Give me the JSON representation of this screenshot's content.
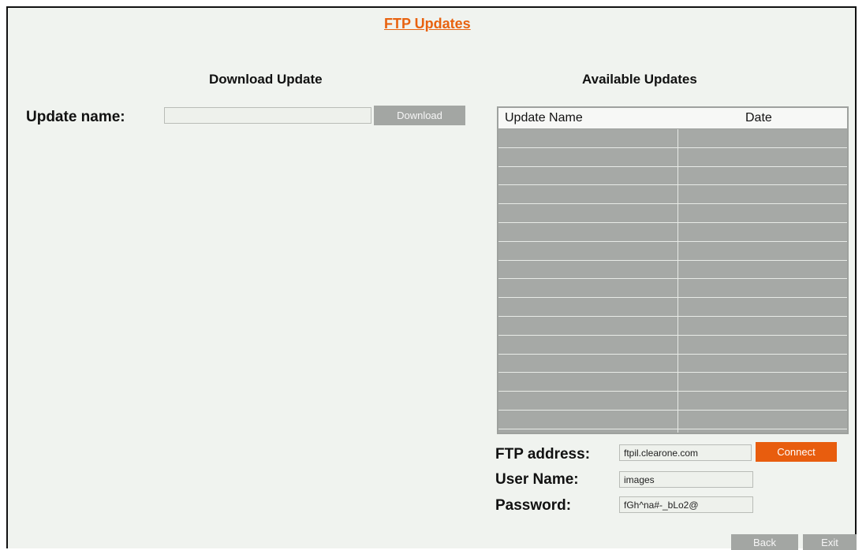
{
  "page": {
    "title": "FTP Updates"
  },
  "download": {
    "section_title": "Download Update",
    "update_name_label": "Update name:",
    "update_name_value": "",
    "download_button": "Download"
  },
  "available": {
    "section_title": "Available Updates",
    "columns": [
      "Update Name",
      "Date"
    ],
    "rows": [
      [
        "",
        ""
      ],
      [
        "",
        ""
      ],
      [
        "",
        ""
      ],
      [
        "",
        ""
      ],
      [
        "",
        ""
      ],
      [
        "",
        ""
      ],
      [
        "",
        ""
      ],
      [
        "",
        ""
      ],
      [
        "",
        ""
      ],
      [
        "",
        ""
      ],
      [
        "",
        ""
      ],
      [
        "",
        ""
      ],
      [
        "",
        ""
      ],
      [
        "",
        ""
      ],
      [
        "",
        ""
      ],
      [
        "",
        ""
      ]
    ]
  },
  "ftp": {
    "address_label": "FTP address:",
    "address_value": "ftpil.clearone.com",
    "connect_button": "Connect",
    "username_label": "User Name:",
    "username_value": "images",
    "password_label": "Password:",
    "password_value": "fGh^na#-_bLo2@"
  },
  "footer": {
    "back_button": "Back",
    "exit_button": "Exit"
  },
  "colors": {
    "accent": "#e85d0e",
    "button_gray": "#a3a6a3",
    "table_gray": "#a6a9a6",
    "background": "#f0f3ef"
  }
}
